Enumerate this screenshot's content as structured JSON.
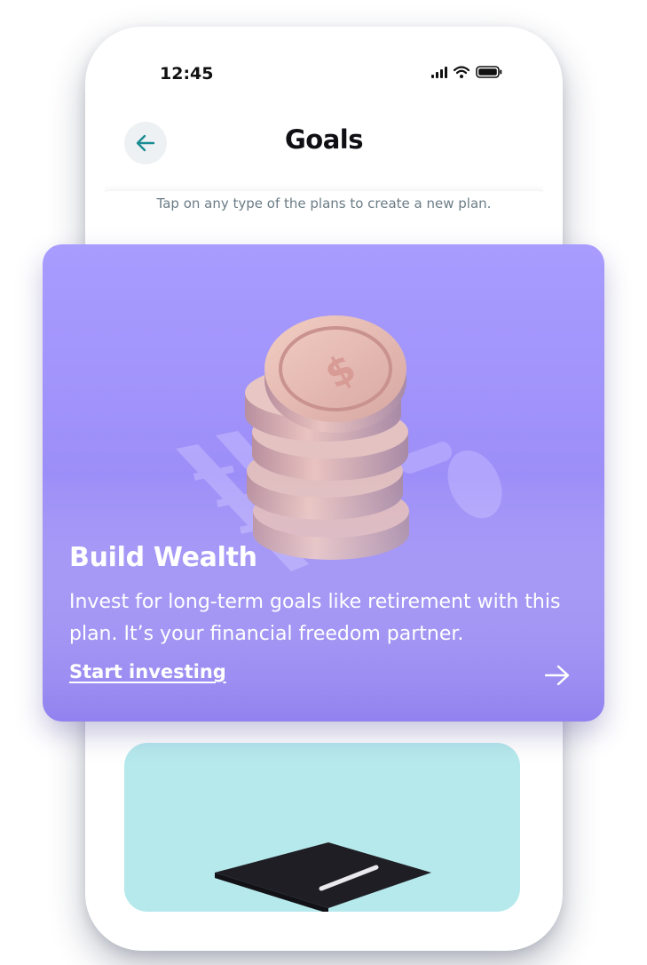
{
  "status_bar": {
    "time": "12:45",
    "icons": [
      "signal-icon",
      "wifi-icon",
      "battery-icon"
    ]
  },
  "header": {
    "back_icon": "arrow-left-icon",
    "title": "Goals"
  },
  "subtitle": "Tap on any type of the plans to create a new plan.",
  "plan_card": {
    "title": "Build Wealth",
    "description": "Invest for long-term goals like retirement with this plan. It’s your financial freedom partner.",
    "cta_label": "Start investing",
    "cta_icon": "arrow-right-icon",
    "background": "#a89cff"
  },
  "next_card": {
    "background": "#b6e9ec"
  },
  "colors": {
    "accent": "#1a8c93",
    "title": "#0f0f14",
    "subtitle": "#6b7c86"
  }
}
